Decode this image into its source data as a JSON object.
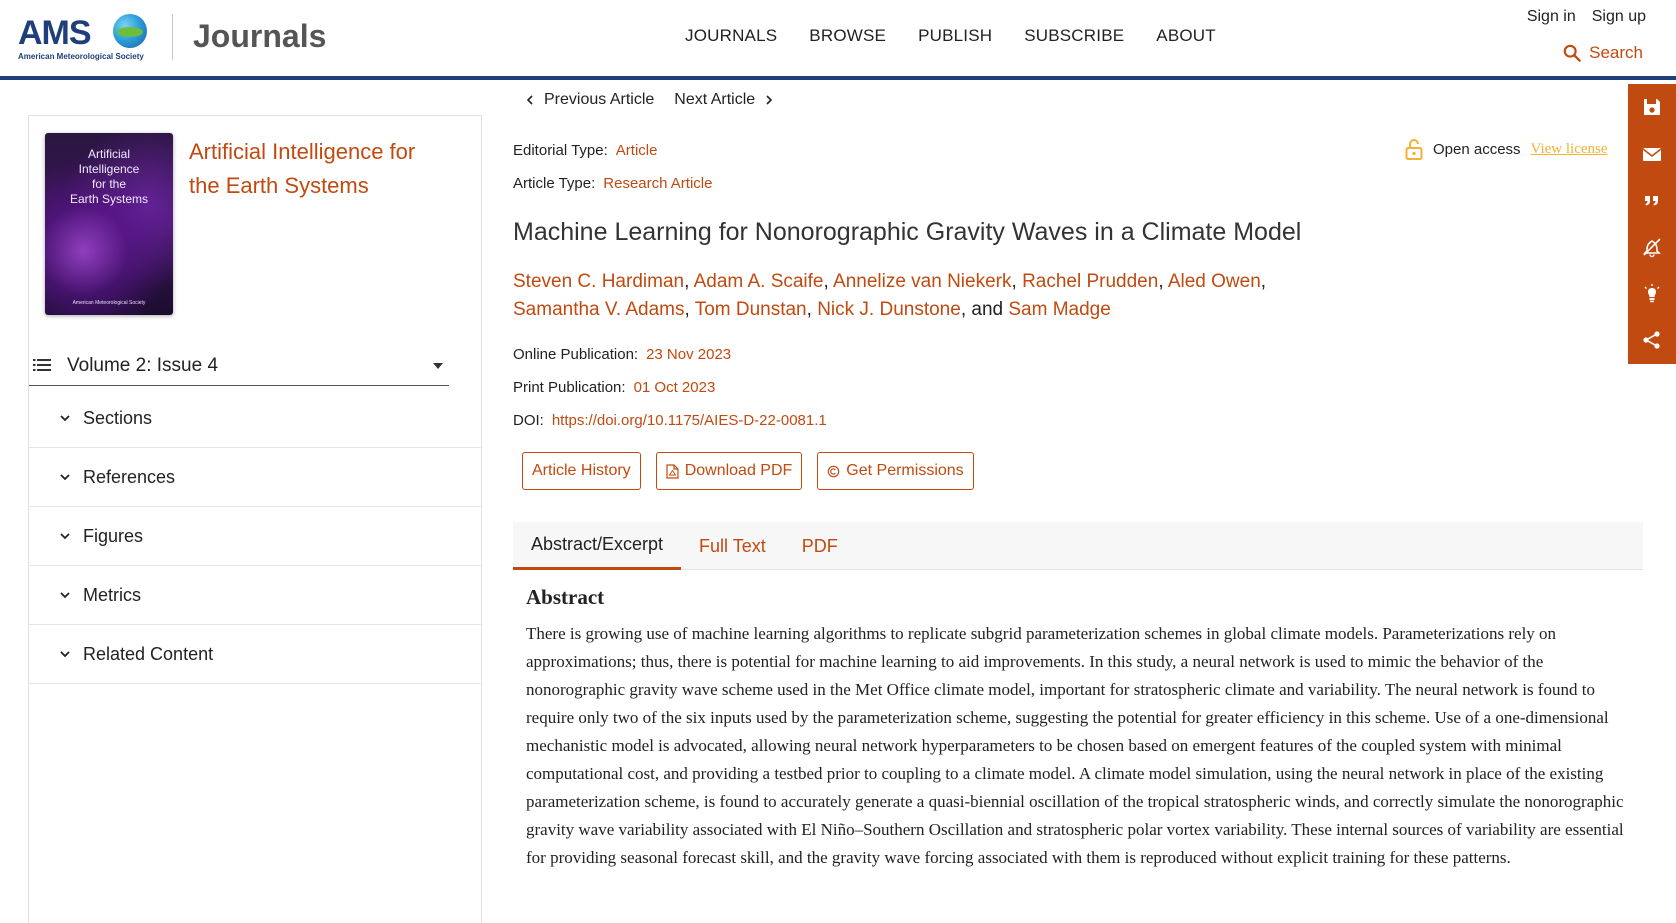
{
  "header": {
    "logo_text": "AMS",
    "logo_subtitle": "American Meteorological Society",
    "site_name": "Journals",
    "nav": [
      "JOURNALS",
      "BROWSE",
      "PUBLISH",
      "SUBSCRIBE",
      "ABOUT"
    ],
    "sign_in": "Sign in",
    "sign_up": "Sign up",
    "search_label": "Search"
  },
  "sidebar": {
    "cover": {
      "title_line1": "Artificial",
      "title_line2": "Intelligence",
      "title_line3": "for the",
      "title_line4": "Earth Systems",
      "footer": "American Meteorological Society"
    },
    "journal_title": "Artificial Intelligence for the Earth Systems",
    "issue": "Volume 2: Issue 4",
    "items": [
      {
        "label": "Sections"
      },
      {
        "label": "References"
      },
      {
        "label": "Figures"
      },
      {
        "label": "Metrics"
      },
      {
        "label": "Related Content"
      }
    ]
  },
  "article_nav": {
    "previous": "Previous Article",
    "next": "Next Article"
  },
  "meta": {
    "editorial_type_label": "Editorial Type:",
    "editorial_type": "Article",
    "article_type_label": "Article Type:",
    "article_type": "Research Article",
    "online_pub_label": "Online Publication:",
    "online_pub": "23 Nov 2023",
    "print_pub_label": "Print Publication:",
    "print_pub": "01 Oct 2023",
    "doi_label": "DOI:",
    "doi": "https://doi.org/10.1175/AIES-D-22-0081.1"
  },
  "access": {
    "label": "Open access",
    "link": "View license"
  },
  "article": {
    "title": "Machine Learning for Nonorographic Gravity Waves in a Climate Model",
    "authors": [
      "Steven C. Hardiman",
      "Adam A. Scaife",
      "Annelize van Niekerk",
      "Rachel Prudden",
      "Aled Owen",
      "Samantha V. Adams",
      "Tom Dunstan",
      "Nick J. Dunstone",
      "Sam Madge"
    ],
    "author_conj": "and"
  },
  "buttons": {
    "history": "Article History",
    "pdf": "Download PDF",
    "permissions": "Get Permissions"
  },
  "tabs": [
    "Abstract/Excerpt",
    "Full Text",
    "PDF"
  ],
  "abstract": {
    "heading": "Abstract",
    "text": "There is growing use of machine learning algorithms to replicate subgrid parameterization schemes in global climate models. Parameterizations rely on approximations; thus, there is potential for machine learning to aid improvements. In this study, a neural network is used to mimic the behavior of the nonorographic gravity wave scheme used in the Met Office climate model, important for stratospheric climate and variability. The neural network is found to require only two of the six inputs used by the parameterization scheme, suggesting the potential for greater efficiency in this scheme. Use of a one-dimensional mechanistic model is advocated, allowing neural network hyperparameters to be chosen based on emergent features of the coupled system with minimal computational cost, and providing a testbed prior to coupling to a climate model. A climate model simulation, using the neural network in place of the existing parameterization scheme, is found to accurately generate a quasi-biennial oscillation of the tropical stratospheric winds, and correctly simulate the nonorographic gravity wave variability associated with El Niño–Southern Oscillation and stratospheric polar vortex variability. These internal sources of variability are essential for providing seasonal forecast skill, and the gravity wave forcing associated with them is reproduced without explicit training for these patterns."
  },
  "toolbar": {
    "icons": [
      "save-icon",
      "email-icon",
      "quote-icon",
      "alert-off-icon",
      "lightbulb-icon",
      "share-icon"
    ]
  },
  "colors": {
    "accent": "#c14a10",
    "header_rule": "#1f3f7a",
    "license_link": "#f3b233"
  }
}
